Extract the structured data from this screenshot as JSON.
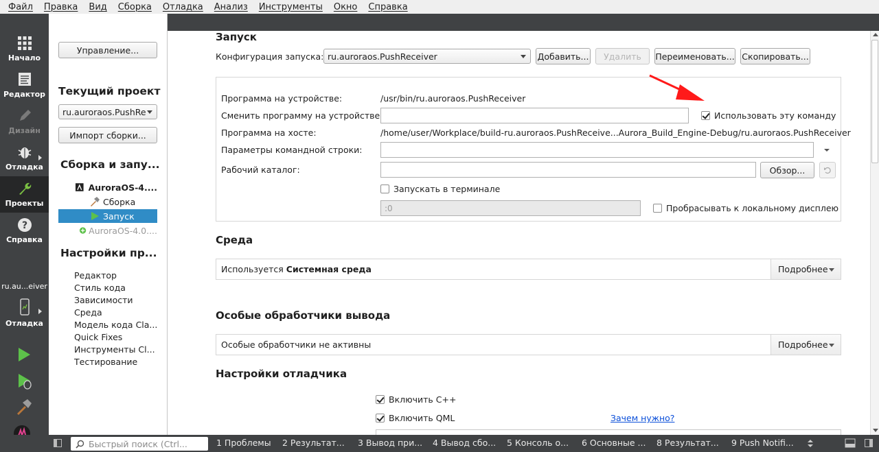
{
  "menubar": {
    "items": [
      "Файл",
      "Правка",
      "Вид",
      "Сборка",
      "Отладка",
      "Анализ",
      "Инструменты",
      "Окно",
      "Справка"
    ]
  },
  "modebar": {
    "modes": [
      {
        "label": "Начало",
        "icon": "grid-icon"
      },
      {
        "label": "Редактор",
        "icon": "document-icon"
      },
      {
        "label": "Дизайн",
        "icon": "pencil-icon"
      },
      {
        "label": "Отладка",
        "icon": "bug-icon"
      },
      {
        "label": "Проекты",
        "icon": "wrench-icon"
      },
      {
        "label": "Справка",
        "icon": "help-icon"
      }
    ],
    "kit_label": "ru.au...eiver",
    "kit_mode_label": "Отладка"
  },
  "nav": {
    "manage_button": "Управление...",
    "current_project_heading": "Текущий проект",
    "project_combo_value": "ru.auroraos.PushRe",
    "import_build_button": "Импорт сборки...",
    "build_run_heading": "Сборка и запу...",
    "tree": {
      "kit": "AuroraOS-4....",
      "build": "Сборка",
      "run": "Запуск",
      "other_kit": "AuroraOS-4.0...."
    },
    "project_settings_heading": "Настройки пр...",
    "settings_links": [
      "Редактор",
      "Стиль кода",
      "Зависимости",
      "Среда",
      "Модель кода Cla...",
      "Quick Fixes",
      "Инструменты Cl...",
      "Тестирование"
    ]
  },
  "run": {
    "section_title": "Запуск",
    "config_label": "Конфигурация запуска:",
    "config_value": "ru.auroraos.PushReceiver",
    "add_button": "Добавить...",
    "remove_button": "Удалить",
    "rename_button": "Переименовать...",
    "clone_button": "Скопировать...",
    "device_program_label": "Программа на устройстве:",
    "device_program_value": "/usr/bin/ru.auroraos.PushReceiver",
    "alt_program_label": "Сменить программу на устройстве:",
    "use_command_label": "Использовать эту команду",
    "use_command_checked": true,
    "host_program_label": "Программа на хосте:",
    "host_program_value": "/home/user/Workplace/build-ru.auroraos.PushReceive...Aurora_Build_Engine-Debug/ru.auroraos.PushReceiver",
    "args_label": "Параметры командной строки:",
    "workdir_label": "Рабочий каталог:",
    "browse_button": "Обзор...",
    "run_in_terminal_label": "Запускать в терминале",
    "run_in_terminal_checked": false,
    "display_value": ":0",
    "forward_display_label": "Пробрасывать к локальному дисплею",
    "forward_display_checked": false
  },
  "env": {
    "section_title": "Среда",
    "summary_prefix": "Используется ",
    "summary_bold": "Системная среда",
    "details_button": "Подробнее"
  },
  "output": {
    "section_title": "Особые обработчики вывода",
    "summary": "Особые обработчики не активны",
    "details_button": "Подробнее"
  },
  "debugger": {
    "section_title": "Настройки отладчика",
    "enable_cpp_label": "Включить C++",
    "enable_cpp_checked": true,
    "enable_qml_label": "Включить QML",
    "enable_qml_checked": true,
    "why_link": "Зачем нужно?"
  },
  "statusbar": {
    "search_placeholder": "Быстрый поиск (Ctrl...",
    "panes": [
      "1  Проблемы",
      "2  Результат...",
      "3  Вывод при...",
      "4  Вывод сбо...",
      "5  Консоль о...",
      "6  Основные ...",
      "8  Результат...",
      "9  Push Notifi..."
    ]
  },
  "colors": {
    "sidebar_dark": "#404244",
    "selection": "#308cc6",
    "annotation_arrow": "#ff1a1a",
    "link": "#0b4fd9"
  }
}
